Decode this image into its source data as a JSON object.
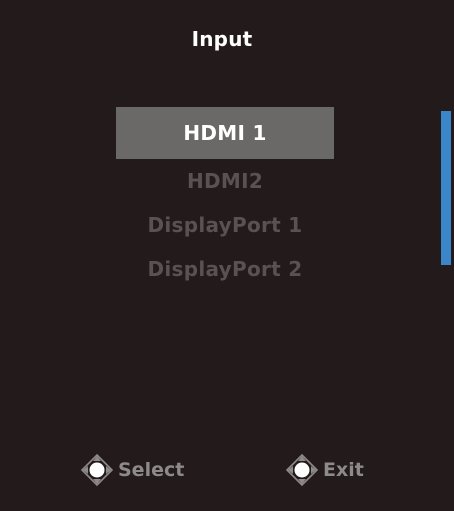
{
  "osd": {
    "title": "Input",
    "menu": {
      "items": [
        {
          "label": "HDMI 1",
          "selected": true
        },
        {
          "label": "HDMI2",
          "selected": false
        },
        {
          "label": "DisplayPort 1",
          "selected": false
        },
        {
          "label": "DisplayPort 2",
          "selected": false
        }
      ]
    },
    "footer": {
      "select": {
        "icon": "joystick-icon",
        "label": "Select"
      },
      "exit": {
        "icon": "joystick-icon",
        "label": "Exit"
      }
    }
  },
  "colors": {
    "background": "#231b1b",
    "selected_bg": "#6b6868",
    "selected_text": "#ffffff",
    "unselected_text": "#5a5252",
    "scroll_indicator": "#3a86c8"
  }
}
